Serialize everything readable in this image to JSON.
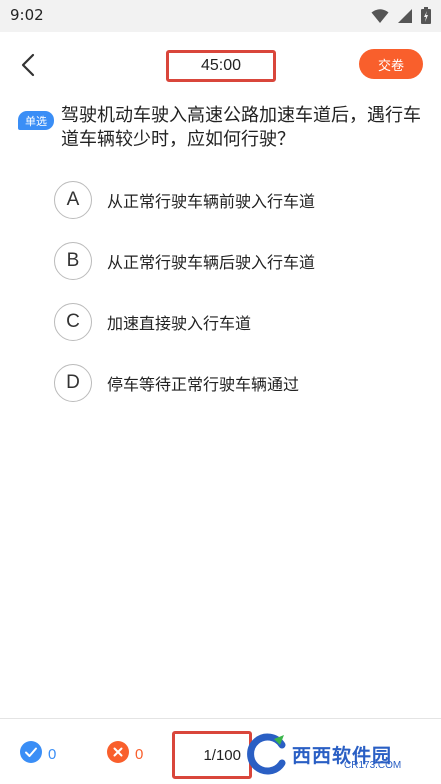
{
  "status_bar": {
    "time": "9:02"
  },
  "header": {
    "timer": "45:00",
    "submit_label": "交卷"
  },
  "question": {
    "type_badge": "单选",
    "text": "驾驶机动车驶入高速公路加速车道后，遇行车道车辆较少时，应如何行驶？"
  },
  "options": [
    {
      "letter": "A",
      "text": "从正常行驶车辆前驶入行车道"
    },
    {
      "letter": "B",
      "text": "从正常行驶车辆后驶入行车道"
    },
    {
      "letter": "C",
      "text": "加速直接驶入行车道"
    },
    {
      "letter": "D",
      "text": "停车等待正常行驶车辆通过"
    }
  ],
  "footer": {
    "correct_count": "0",
    "wrong_count": "0",
    "progress": "1/100"
  },
  "watermark": {
    "name": "西西软件园",
    "domain": "CR173.COM"
  },
  "colors": {
    "accent_blue": "#3a8ef6",
    "accent_orange": "#f95f2c",
    "highlight_red": "#d9463b"
  },
  "icons": [
    "wifi-icon",
    "signal-icon",
    "battery-icon",
    "back-arrow-icon",
    "check-circle-icon",
    "cross-circle-icon"
  ]
}
